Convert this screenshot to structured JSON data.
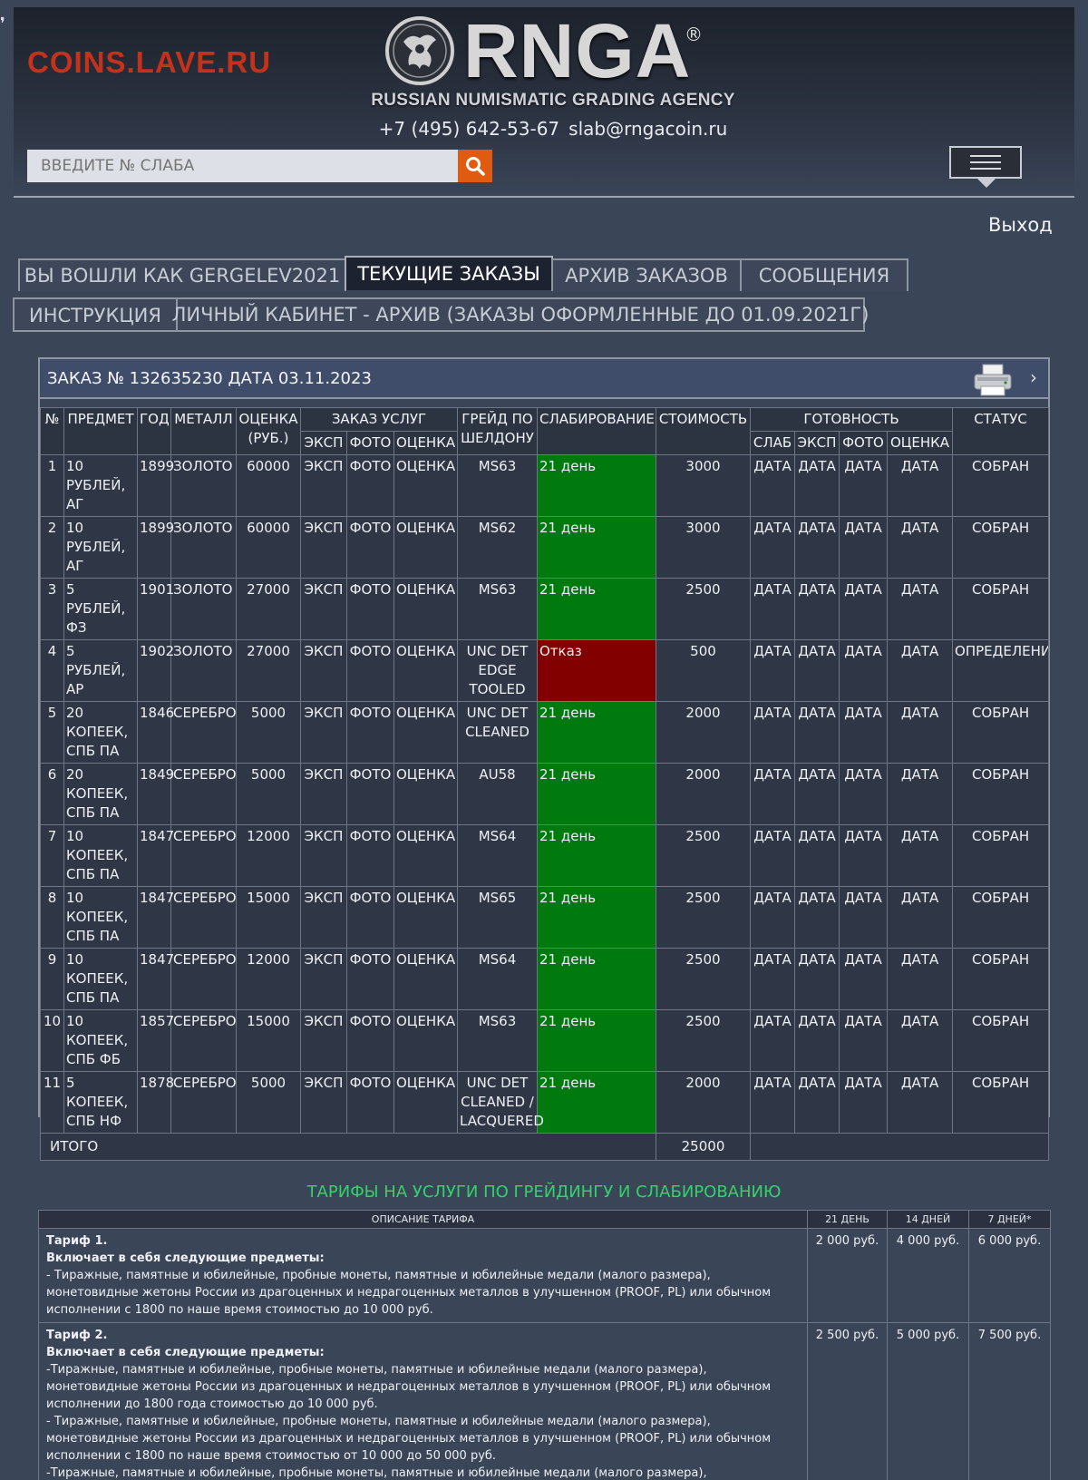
{
  "header": {
    "site_tag": "COINS.LAVE.RU",
    "logo_text": "RNGA",
    "logo_reg": "®",
    "agency_name": "RUSSIAN NUMISMATIC GRADING AGENCY",
    "phone": "+7 (495) 642-53-67",
    "email": "slab@rngacoin.ru",
    "search_placeholder": "ВВЕДИТЕ № СЛАБА"
  },
  "logout": "Выход",
  "tabs": {
    "row1": [
      "ВЫ ВОШЛИ КАК GERGELEV2021",
      "ТЕКУЩИЕ ЗАКАЗЫ",
      "АРХИВ ЗАКАЗОВ",
      "СООБЩЕНИЯ"
    ],
    "row2": [
      "ИНСТРУКЦИЯ",
      "ЛИЧНЫЙ КАБИНЕТ - АРХИВ (ЗАКАЗЫ ОФОРМЛЕННЫЕ ДО 01.09.2021Г)"
    ]
  },
  "order": {
    "title": "ЗАКАЗ № 132635230 ДАТА 03.11.2023",
    "columns": {
      "num": "№",
      "item": "ПРЕДМЕТ",
      "year": "ГОД",
      "metal": "МЕТАЛЛ",
      "estimate": "ОЦЕНКА (РУБ.)",
      "services": "ЗАКАЗ УСЛУГ",
      "grade": "ГРЕЙД ПО ШЕЛДОНУ",
      "slabbing": "СЛАБИРОВАНИЕ",
      "cost": "СТОИМОСТЬ",
      "readiness": "ГОТОВНОСТЬ",
      "status": "СТАТУС",
      "svc_exp": "ЭКСП",
      "svc_photo": "ФОТО",
      "svc_est": "ОЦЕНКА",
      "rd_slab": "СЛАБ",
      "rd_exp": "ЭКСП",
      "rd_photo": "ФОТО",
      "rd_est": "ОЦЕНКА"
    },
    "placeholders": {
      "exp": "ЭКСП",
      "photo": "ФОТО",
      "est": "ОЦЕНКА",
      "date": "ДАТА"
    },
    "rows": [
      {
        "n": "1",
        "item": "10 РУБЛЕЙ, АГ",
        "year": "1899",
        "metal": "ЗОЛОТО",
        "est": "60000",
        "grade": "MS63",
        "slab": "21 день",
        "slab_color": "green",
        "cost": "3000",
        "status": "СОБРАН"
      },
      {
        "n": "2",
        "item": "10 РУБЛЕЙ, АГ",
        "year": "1899",
        "metal": "ЗОЛОТО",
        "est": "60000",
        "grade": "MS62",
        "slab": "21 день",
        "slab_color": "green",
        "cost": "3000",
        "status": "СОБРАН"
      },
      {
        "n": "3",
        "item": "5 РУБЛЕЙ, ФЗ",
        "year": "1901",
        "metal": "ЗОЛОТО",
        "est": "27000",
        "grade": "MS63",
        "slab": "21 день",
        "slab_color": "green",
        "cost": "2500",
        "status": "СОБРАН"
      },
      {
        "n": "4",
        "item": "5 РУБЛЕЙ, АР",
        "year": "1902",
        "metal": "ЗОЛОТО",
        "est": "27000",
        "grade": "UNC DET EDGE TOOLED",
        "slab": "Отказ",
        "slab_color": "red",
        "cost": "500",
        "status": "ОПРЕДЕЛЕНИЕ СОХРАННОСТИ"
      },
      {
        "n": "5",
        "item": "20 КОПЕЕК, СПБ ПА",
        "year": "1846",
        "metal": "СЕРЕБРО",
        "est": "5000",
        "grade": "UNC DET CLEANED",
        "slab": "21 день",
        "slab_color": "green",
        "cost": "2000",
        "status": "СОБРАН"
      },
      {
        "n": "6",
        "item": "20 КОПЕЕК, СПБ ПА",
        "year": "1849",
        "metal": "СЕРЕБРО",
        "est": "5000",
        "grade": "AU58",
        "slab": "21 день",
        "slab_color": "green",
        "cost": "2000",
        "status": "СОБРАН"
      },
      {
        "n": "7",
        "item": "10 КОПЕЕК, СПБ ПА",
        "year": "1847",
        "metal": "СЕРЕБРО",
        "est": "12000",
        "grade": "MS64",
        "slab": "21 день",
        "slab_color": "green",
        "cost": "2500",
        "status": "СОБРАН"
      },
      {
        "n": "8",
        "item": "10 КОПЕЕК, СПБ ПА",
        "year": "1847",
        "metal": "СЕРЕБРО",
        "est": "15000",
        "grade": "MS65",
        "slab": "21 день",
        "slab_color": "green",
        "cost": "2500",
        "status": "СОБРАН"
      },
      {
        "n": "9",
        "item": "10 КОПЕЕК, СПБ ПА",
        "year": "1847",
        "metal": "СЕРЕБРО",
        "est": "12000",
        "grade": "MS64",
        "slab": "21 день",
        "slab_color": "green",
        "cost": "2500",
        "status": "СОБРАН"
      },
      {
        "n": "10",
        "item": "10 КОПЕЕК, СПБ ФБ",
        "year": "1857",
        "metal": "СЕРЕБРО",
        "est": "15000",
        "grade": "MS63",
        "slab": "21 день",
        "slab_color": "green",
        "cost": "2500",
        "status": "СОБРАН"
      },
      {
        "n": "11",
        "item": "5 КОПЕЕК, СПБ НФ",
        "year": "1878",
        "metal": "СЕРЕБРО",
        "est": "5000",
        "grade": "UNC DET CLEANED / LACQUERED",
        "slab": "21 день",
        "slab_color": "green",
        "cost": "2000",
        "status": "СОБРАН"
      }
    ],
    "total_label": "ИТОГО",
    "total_value": "25000"
  },
  "tariffs": {
    "title": "ТАРИФЫ НА УСЛУГИ ПО ГРЕЙДИНГУ И СЛАБИРОВАНИЮ",
    "columns": [
      "ОПИСАНИЕ ТАРИФА",
      "21 ДЕНЬ",
      "14 ДНЕЙ",
      "7 ДНЕЙ*"
    ],
    "rows": [
      {
        "name": "Тариф 1.",
        "includes": "Включает в себя следующие предметы:",
        "lines": [
          "- Тиражные, памятные и юбилейные, пробные монеты, памятные и юбилейные медали (малого размера), монетовидные жетоны России из драгоценных и недрагоценных металлов в улучшенном (PROOF, PL) или обычном исполнении с 1800 по наше время стоимостью до 10 000 руб."
        ],
        "prices": [
          "2 000 руб.",
          "4 000 руб.",
          "6 000 руб."
        ]
      },
      {
        "name": "Тариф 2.",
        "includes": "Включает в себя следующие предметы:",
        "lines": [
          "-Тиражные, памятные и юбилейные, пробные монеты, памятные и юбилейные медали (малого размера), монетовидные жетоны России из драгоценных и недрагоценных металлов в улучшенном (PROOF, PL) или обычном исполнении до 1800 года стоимостью до 10 000 руб.",
          "- Тиражные, памятные и юбилейные, пробные монеты, памятные и юбилейные медали (малого размера), монетовидные жетоны России из драгоценных и недрагоценных металлов в улучшенном (PROOF, PL) или обычном исполнении с 1800 по наше время стоимостью от 10 000 до 50 000 руб.",
          "-Тиражные, памятные и юбилейные, пробные монеты, памятные и юбилейные медали (малого размера), монетовидные"
        ],
        "prices": [
          "2 500 руб.",
          "5 000 руб.",
          "7 500 руб."
        ]
      }
    ]
  },
  "colors": {
    "accent_orange": "#e05a10",
    "site_tag_red": "#c4321b",
    "ok_green": "#007a0f",
    "fail_red": "#820000",
    "tariff_title": "#33d36b"
  },
  "icons": {
    "search": "search-icon",
    "menu": "hamburger-icon",
    "printer": "printer-icon",
    "chevron": "chevron-right-icon",
    "emblem": "eagle-emblem-icon"
  }
}
